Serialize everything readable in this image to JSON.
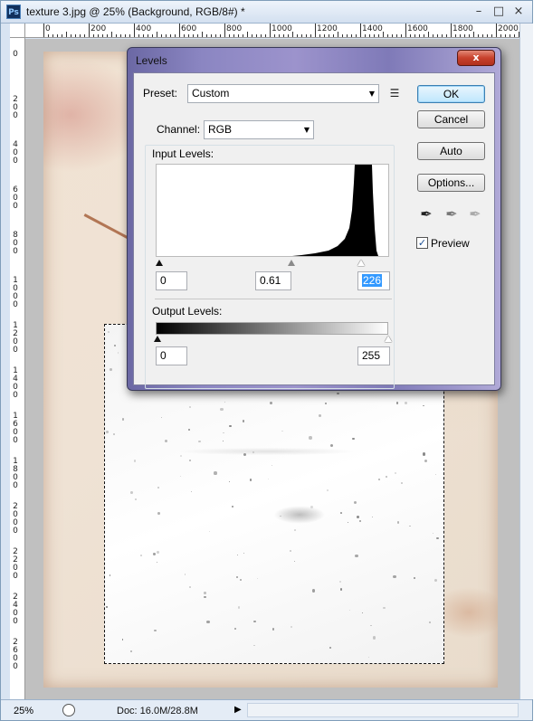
{
  "window": {
    "title": "texture 3.jpg @ 25% (Background, RGB/8#) *",
    "app_icon": "Ps",
    "minimize": "–",
    "maximize": "□",
    "close": "×"
  },
  "rulers": {
    "horizontal": [
      "0",
      "200",
      "400",
      "600",
      "800",
      "1000",
      "1200",
      "1400",
      "1600",
      "1800",
      "2000"
    ],
    "vertical": [
      "0",
      "200",
      "400",
      "600",
      "800",
      "1000",
      "1200",
      "1400",
      "1600",
      "1800",
      "2000",
      "2200",
      "2400",
      "2600"
    ]
  },
  "status": {
    "zoom": "25%",
    "doc_info": "Doc: 16.0M/28.8M",
    "arrow": "▶"
  },
  "levels": {
    "title": "Levels",
    "close_label": "x",
    "preset_label": "Preset:",
    "preset_value": "Custom",
    "channel_label": "Channel:",
    "channel_value": "RGB",
    "input_levels_label": "Input Levels:",
    "input_black": "0",
    "input_gamma": "0.61",
    "input_white": "226",
    "output_levels_label": "Output Levels:",
    "output_black": "0",
    "output_white": "255",
    "buttons": {
      "ok": "OK",
      "cancel": "Cancel",
      "auto": "Auto",
      "options": "Options..."
    },
    "preview_label": "Preview",
    "preview_checked": true
  }
}
